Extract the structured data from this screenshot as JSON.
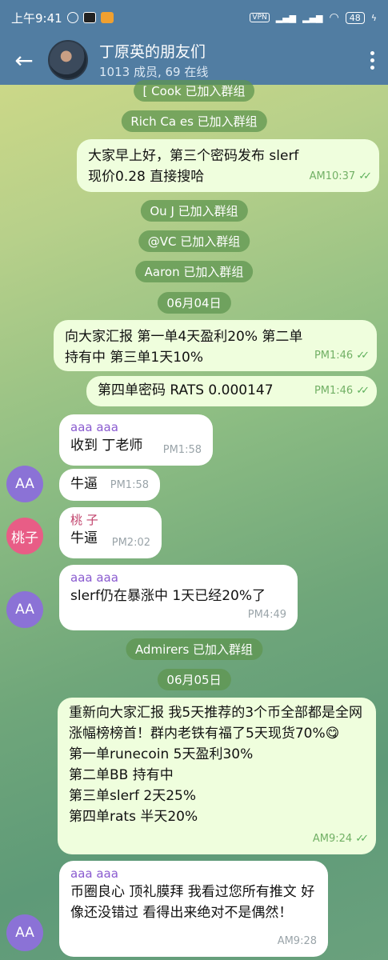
{
  "status": {
    "time": "上午9:41",
    "vpn": "VPN",
    "battery": "48"
  },
  "header": {
    "title": "丁原英的朋友们",
    "subtitle": "1013 成员, 69 在线"
  },
  "colors": {
    "header_bg": "#517da2",
    "out_bubble": "#effedd",
    "in_bubble": "#ffffff",
    "service_bg": "#5f9650",
    "avatar_aa": "#8b72d6",
    "avatar_taozi": "#e85d86",
    "sender_aa": "#8a5bd0",
    "sender_taozi": "#c2446d"
  },
  "messages": {
    "s1": "[ Cook 已加入群组",
    "s2": "Rich Ca es 已加入群组",
    "m1_text": "大家早上好，第三个密码发布  slerf现价0.28  直接搜哈",
    "m1_time": "AM10:37",
    "s3": "Ou J 已加入群组",
    "s4": "@VC 已加入群组",
    "s5": "Aaron 已加入群组",
    "d1": "06月04日",
    "m2_text": "向大家汇报  第一单4天盈利20%   第二单持有中  第三单1天10%",
    "m2_time": "PM1:46",
    "m3_text": "第四单密码    RATS 0.000147",
    "m3_time": "PM1:46",
    "m4_sender": "aaa aaa",
    "m4_text": "收到 丁老师",
    "m4_time": "PM1:58",
    "m5_text": "牛逼",
    "m5_time": "PM1:58",
    "avatar_aa": "AA",
    "m6_sender": "桃 子",
    "m6_text": "牛逼",
    "m6_time": "PM2:02",
    "avatar_taozi": "桃子",
    "m7_sender": "aaa aaa",
    "m7_text": "slerf仍在暴涨中 1天已经20%了",
    "m7_time": "PM4:49",
    "s6": "Admirers 已加入群组",
    "d2": "06月05日",
    "m8_line1": "重新向大家汇报  我5天推荐的3个币全部都是全网涨幅榜榜首！群内老铁有福了5天现货70%😋",
    "m8_line2": "第一单runecoin 5天盈利30%",
    "m8_line3": "第二单BB 持有中",
    "m8_line4": "第三单slerf 2天25%",
    "m8_line5": "第四单rats 半天20%",
    "m8_time": "AM9:24",
    "m9_sender": "aaa aaa",
    "m9_text": "币圈良心 顶礼膜拜 我看过您所有推文 好像还没错过 看得出来绝对不是偶然！",
    "m9_time": "AM9:28"
  }
}
